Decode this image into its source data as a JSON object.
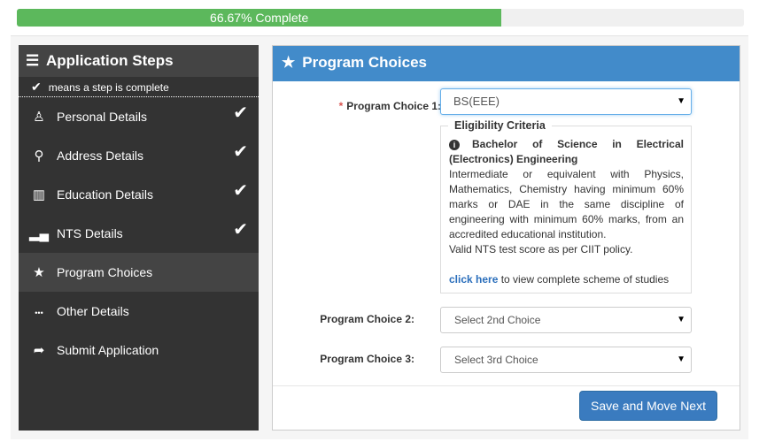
{
  "progress": {
    "percent": 66.67,
    "label": "66.67% Complete",
    "color": "#5cb85c"
  },
  "sidebar": {
    "title": "Application Steps",
    "legend": "means a step is complete",
    "items": [
      {
        "label": "Personal Details",
        "icon": "person-icon",
        "complete": true
      },
      {
        "label": "Address Details",
        "icon": "map-marker-icon",
        "complete": true
      },
      {
        "label": "Education Details",
        "icon": "book-icon",
        "complete": true
      },
      {
        "label": "NTS Details",
        "icon": "bar-chart-icon",
        "complete": true
      },
      {
        "label": "Program Choices",
        "icon": "star-icon",
        "complete": false,
        "active": true
      },
      {
        "label": "Other Details",
        "icon": "ellipsis-icon",
        "complete": false
      },
      {
        "label": "Submit Application",
        "icon": "share-arrow-icon",
        "complete": false
      }
    ]
  },
  "panel": {
    "title": "Program Choices",
    "header_color": "#428bca",
    "choice1": {
      "label": "Program Choice 1:",
      "value": "BS(EEE)"
    },
    "criteria": {
      "legend": "Eligibility Criteria",
      "program": "Bachelor of Science in Electrical (Electronics) Engineering",
      "requirement": "Intermediate or equivalent with Physics, Mathematics, Chemistry having minimum 60% marks or DAE in the same discipline of engineering with minimum 60% marks, from an accredited educational institution.",
      "nts": "Valid NTS test score as per CIIT policy.",
      "link": "click here",
      "link_suffix": " to view complete scheme of studies"
    },
    "choice2": {
      "label": "Program Choice 2:",
      "value": "Select 2nd Choice"
    },
    "choice3": {
      "label": "Program Choice 3:",
      "value": "Select 3rd Choice"
    },
    "save_label": "Save and Move Next"
  }
}
